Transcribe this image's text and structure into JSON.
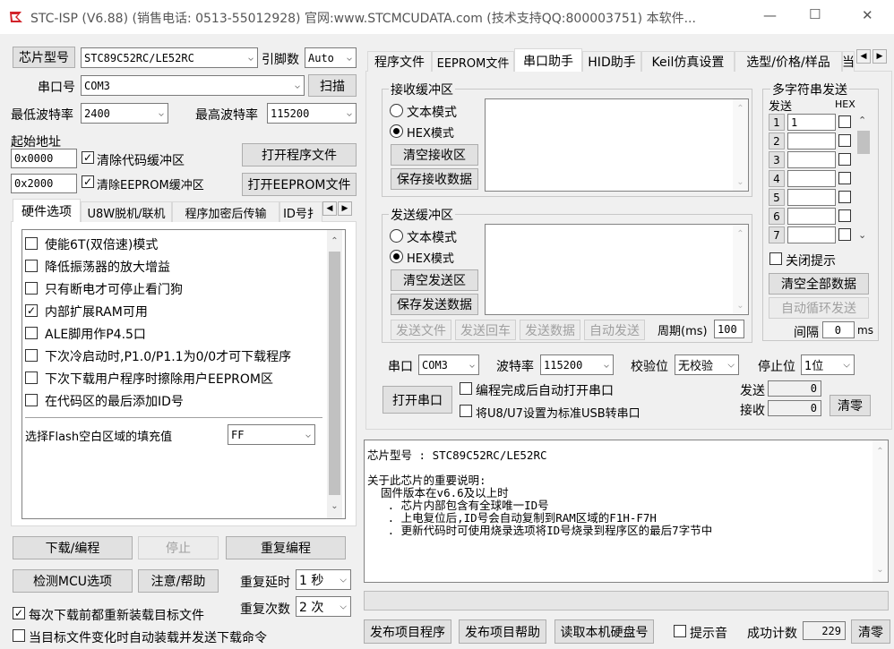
{
  "window": {
    "title": "STC-ISP (V6.88) (销售电话: 0513-55012928) 官网:www.STCMCUDATA.com  (技术支持QQ:800003751) 本软件...",
    "min": "—",
    "max": "☐",
    "close": "✕"
  },
  "left": {
    "chip_type_btn": "芯片型号",
    "chip_type_value": "STC89C52RC/LE52RC",
    "pin_label": "引脚数",
    "pin_value": "Auto",
    "port_label": "串口号",
    "port_value": "COM3",
    "scan_btn": "扫描",
    "min_baud_label": "最低波特率",
    "min_baud_value": "2400",
    "max_baud_label": "最高波特率",
    "max_baud_value": "115200",
    "start_addr_label": "起始地址",
    "addr1": "0x0000",
    "clear_code": "清除代码缓冲区",
    "open_prog": "打开程序文件",
    "addr2": "0x2000",
    "clear_eeprom": "清除EEPROM缓冲区",
    "open_eeprom": "打开EEPROM文件",
    "tabs": [
      "硬件选项",
      "U8W脱机/联机",
      "程序加密后传输",
      "ID号扌"
    ],
    "options": [
      {
        "label": "使能6T(双倍速)模式",
        "checked": false
      },
      {
        "label": "降低振荡器的放大增益",
        "checked": false
      },
      {
        "label": "只有断电才可停止看门狗",
        "checked": false
      },
      {
        "label": "内部扩展RAM可用",
        "checked": true
      },
      {
        "label": "ALE脚用作P4.5口",
        "checked": false
      },
      {
        "label": "下次冷启动时,P1.0/P1.1为0/0才可下载程序",
        "checked": false
      },
      {
        "label": "下次下载用户程序时擦除用户EEPROM区",
        "checked": false
      },
      {
        "label": "在代码区的最后添加ID号",
        "checked": false
      }
    ],
    "fill_label": "选择Flash空白区域的填充值",
    "fill_value": "FF",
    "download_btn": "下载/编程",
    "stop_btn": "停止",
    "reprogram_btn": "重复编程",
    "detect_btn": "检测MCU选项",
    "help_btn": "注意/帮助",
    "repeat_delay_label": "重复延时",
    "repeat_delay_value": "1 秒",
    "repeat_count_label": "重复次数",
    "repeat_count_value": "2 次",
    "reload_chk": "每次下载前都重新装载目标文件",
    "auto_send_chk": "当目标文件变化时自动装载并发送下载命令"
  },
  "right": {
    "tabs": [
      "程序文件",
      "EEPROM文件",
      "串口助手",
      "HID助手",
      "Keil仿真设置",
      "选型/价格/样品",
      "当"
    ],
    "recv_title": "接收缓冲区",
    "text_mode": "文本模式",
    "hex_mode": "HEX模式",
    "clear_recv": "清空接收区",
    "save_recv": "保存接收数据",
    "send_title": "发送缓冲区",
    "clear_send": "清空发送区",
    "save_send": "保存发送数据",
    "send_file": "发送文件",
    "send_back": "发送回车",
    "send_data": "发送数据",
    "auto_send": "自动发送",
    "period_label": "周期(ms)",
    "period_value": "100",
    "multi_title": "多字符串发送",
    "send_col": "发送",
    "hex_col": "HEX",
    "rows": [
      "1",
      "2",
      "3",
      "4",
      "5",
      "6",
      "7"
    ],
    "row1_value": "1",
    "close_tip": "关闭提示",
    "clear_all": "清空全部数据",
    "auto_loop": "自动循环发送",
    "interval_label": "间隔",
    "interval_value": "0",
    "interval_unit": "ms",
    "port_label": "串口",
    "port_value": "COM3",
    "baud_label": "波特率",
    "baud_value": "115200",
    "parity_label": "校验位",
    "parity_value": "无校验",
    "stop_label": "停止位",
    "stop_value": "1位",
    "open_port": "打开串口",
    "auto_open": "编程完成后自动打开串口",
    "usb_chk": "将U8/U7设置为标准USB转串口",
    "send_count_label": "发送",
    "send_count": "0",
    "recv_count_label": "接收",
    "recv_count": "0",
    "clear_count": "清零",
    "info_lines": [
      "芯片型号 : STC89C52RC/LE52RC",
      "",
      "关于此芯片的重要说明:",
      "  固件版本在v6.6及以上时",
      "   . 芯片内部包含有全球唯一ID号",
      "   . 上电复位后,ID号会自动复制到RAM区域的F1H-F7H",
      "   . 更新代码时可使用烧录选项将ID号烧录到程序区的最后7字节中"
    ],
    "publish_prog": "发布项目程序",
    "publish_help": "发布项目帮助",
    "read_disk": "读取本机硬盘号",
    "tone_chk": "提示音",
    "success_label": "成功计数",
    "success_value": "229",
    "clear2": "清零"
  },
  "colors": {
    "accent": "#0078d7",
    "check": "#000000"
  }
}
